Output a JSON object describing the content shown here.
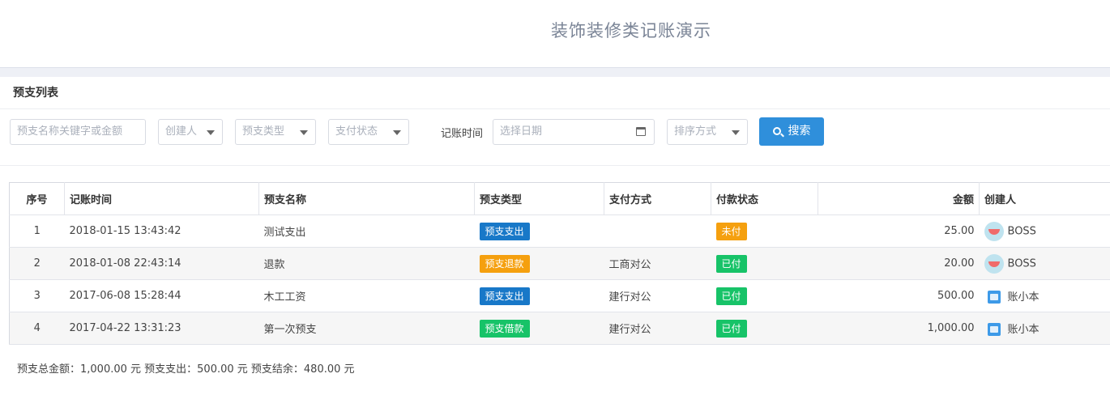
{
  "app_title": "装饰装修类记账演示",
  "panel_title": "预支列表",
  "filters": {
    "keyword_placeholder": "预支名称关键字或金额",
    "creator": "创建人",
    "type": "预支类型",
    "pay_status": "支付状态",
    "time_label": "记账时间",
    "date_placeholder": "选择日期",
    "sort": "排序方式",
    "search_label": "搜索"
  },
  "columns": [
    "序号",
    "记账时间",
    "预支名称",
    "预支类型",
    "支付方式",
    "付款状态",
    "金额",
    "创建人"
  ],
  "rows": [
    {
      "idx": "1",
      "time": "2018-01-15 13:43:42",
      "name": "测试支出",
      "type": "预支支出",
      "type_color": "#1878c8",
      "method": "",
      "status": "未付",
      "status_color": "#f5a00f",
      "amount": "25.00",
      "creator": "BOSS",
      "avatar": "watermelon-avatar"
    },
    {
      "idx": "2",
      "time": "2018-01-08 22:43:14",
      "name": "退款",
      "type": "预支退款",
      "type_color": "#f5a00f",
      "method": "工商对公",
      "status": "已付",
      "status_color": "#17c368",
      "amount": "20.00",
      "creator": "BOSS",
      "avatar": "watermelon-avatar"
    },
    {
      "idx": "3",
      "time": "2017-06-08 15:28:44",
      "name": "木工工资",
      "type": "预支支出",
      "type_color": "#1878c8",
      "method": "建行对公",
      "status": "已付",
      "status_color": "#17c368",
      "amount": "500.00",
      "creator": "账小本",
      "avatar": "ledger-avatar"
    },
    {
      "idx": "4",
      "time": "2017-04-22 13:31:23",
      "name": "第一次预支",
      "type": "预支借款",
      "type_color": "#17c368",
      "method": "建行对公",
      "status": "已付",
      "status_color": "#17c368",
      "amount": "1,000.00",
      "creator": "账小本",
      "avatar": "ledger-avatar"
    }
  ],
  "summary": "预支总金额：1,000.00 元 预支支出：500.00 元 预支结余：480.00 元"
}
